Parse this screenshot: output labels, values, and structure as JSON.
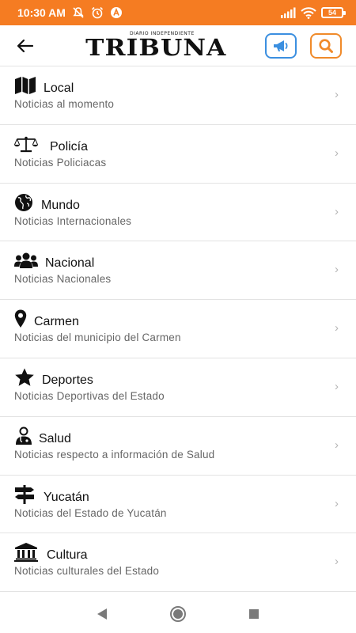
{
  "status_bar": {
    "time": "10:30 AM",
    "battery": "54"
  },
  "app_bar": {
    "logo_small": "DIARIO INDEPENDIENTE",
    "logo_main": "TRIBUNA"
  },
  "menu": {
    "items": [
      {
        "icon": "map-icon",
        "title": "Local",
        "subtitle": "Noticias al momento"
      },
      {
        "icon": "scales-icon",
        "title": "Policía",
        "subtitle": "Noticias Policiacas"
      },
      {
        "icon": "globe-icon",
        "title": "Mundo",
        "subtitle": "Noticias Internacionales"
      },
      {
        "icon": "users-icon",
        "title": "Nacional",
        "subtitle": "Noticias Nacionales"
      },
      {
        "icon": "map-pin-icon",
        "title": "Carmen",
        "subtitle": "Noticias del municipio del Carmen"
      },
      {
        "icon": "star-icon",
        "title": "Deportes",
        "subtitle": "Noticias Deportivas del Estado"
      },
      {
        "icon": "doctor-icon",
        "title": "Salud",
        "subtitle": "Noticias respecto a información de Salud"
      },
      {
        "icon": "signpost-icon",
        "title": "Yucatán",
        "subtitle": "Noticias del Estado de Yucatán"
      },
      {
        "icon": "museum-icon",
        "title": "Cultura",
        "subtitle": "Noticias culturales del Estado"
      }
    ],
    "chevron": "›"
  },
  "colors": {
    "status_bar": "#f57c22",
    "megaphone_accent": "#3b8fe0",
    "search_accent": "#f08a2a"
  }
}
